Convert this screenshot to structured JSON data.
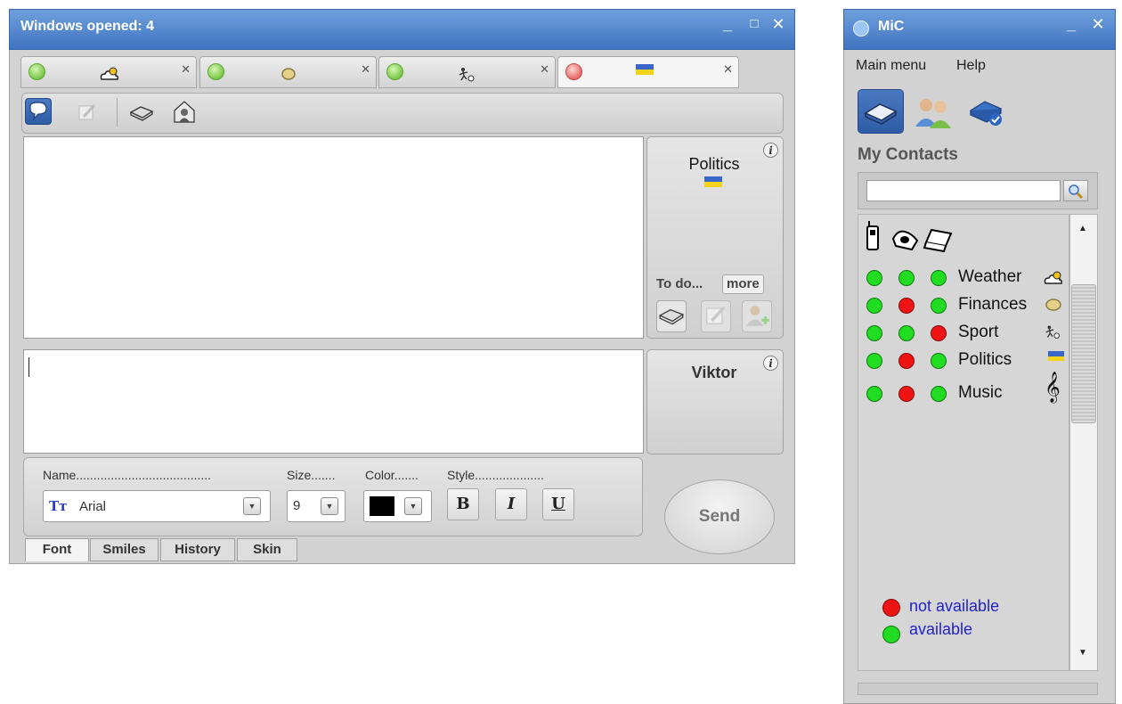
{
  "chat_window": {
    "title": "Windows opened: 4",
    "controls": {
      "minimize": "_",
      "maximize": "□",
      "close": "✕"
    },
    "tabs": [
      {
        "status": "green",
        "icon": "cloud-sun-icon"
      },
      {
        "status": "green",
        "icon": "coin-icon"
      },
      {
        "status": "green",
        "icon": "soccer-icon"
      },
      {
        "status": "red",
        "icon": "flag-icon"
      }
    ],
    "tab_close": "✕",
    "topic": "Politics",
    "todo_label": "To do...",
    "more_label": "more",
    "info_glyph": "i",
    "contact_name": "Viktor",
    "send_label": "Send",
    "font": {
      "name_label": "Name.......................................",
      "size_label": "Size.......",
      "color_label": "Color.......",
      "style_label": "Style....................",
      "font_value": "Arial",
      "size_value": "9",
      "color_value": "#000000",
      "bold": "B",
      "italic": "I",
      "underline": "U"
    },
    "bottom_tabs": [
      "Font",
      "Smiles",
      "History",
      "Skin"
    ]
  },
  "mic_window": {
    "title": "MiC",
    "controls": {
      "minimize": "_",
      "close": "✕"
    },
    "menu": [
      "Main menu",
      "Help"
    ],
    "section_title": "My Contacts",
    "search_placeholder": "",
    "device_icons": [
      "phone-icon",
      "telephone-icon",
      "laptop-icon"
    ],
    "contacts": [
      {
        "name": "Weather",
        "status": [
          "green",
          "green",
          "green"
        ],
        "icon": "cloud-sun-icon"
      },
      {
        "name": "Finances",
        "status": [
          "green",
          "red",
          "green"
        ],
        "icon": "coin-icon"
      },
      {
        "name": "Sport",
        "status": [
          "green",
          "green",
          "red"
        ],
        "icon": "soccer-icon"
      },
      {
        "name": "Politics",
        "status": [
          "green",
          "red",
          "green"
        ],
        "icon": "flag-icon"
      },
      {
        "name": "Music",
        "status": [
          "green",
          "red",
          "green"
        ],
        "icon": "treble-clef-icon",
        "icon_glyph": "𝄞"
      }
    ],
    "legend": {
      "not_available": "not available",
      "available": "available"
    },
    "colors": {
      "available": "#22dc22",
      "not_available": "#ee1414",
      "legend_text": "#2222cc",
      "title_bar": "#4a7cc8"
    }
  }
}
